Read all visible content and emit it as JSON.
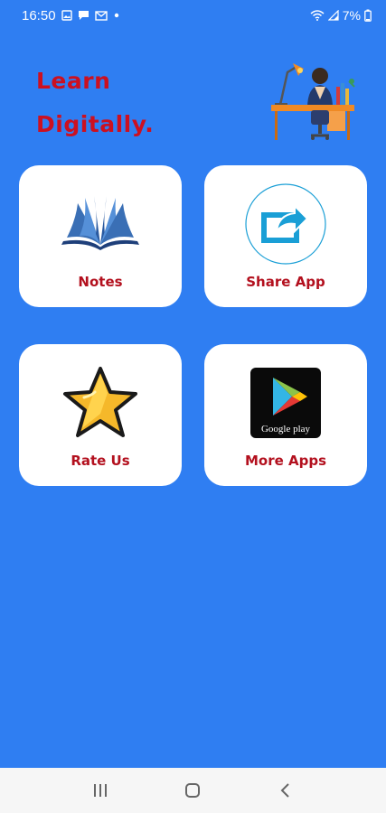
{
  "status_bar": {
    "time": "16:50",
    "battery": "7%",
    "icons": [
      "image-icon",
      "message-icon",
      "mail-icon",
      "dot-icon",
      "wifi-icon",
      "signal-icon",
      "battery-icon"
    ]
  },
  "header": {
    "title_line1": "Learn",
    "title_line2": "Digitally.",
    "title_color": "#cc1020",
    "illustration": "person-at-desk-illustration"
  },
  "menu": {
    "notes": {
      "label": "Notes",
      "icon": "open-book-icon"
    },
    "share": {
      "label": "Share App",
      "icon": "share-icon"
    },
    "rate": {
      "label": "Rate Us",
      "icon": "star-icon"
    },
    "more": {
      "label": "More Apps",
      "icon": "google-play-icon",
      "badge_text": "Google play"
    }
  },
  "nav_bar": {
    "buttons": [
      "recent-apps-icon",
      "home-icon",
      "back-icon"
    ]
  },
  "colors": {
    "background": "#2f7ef2",
    "card": "#ffffff",
    "label": "#b3101e"
  }
}
